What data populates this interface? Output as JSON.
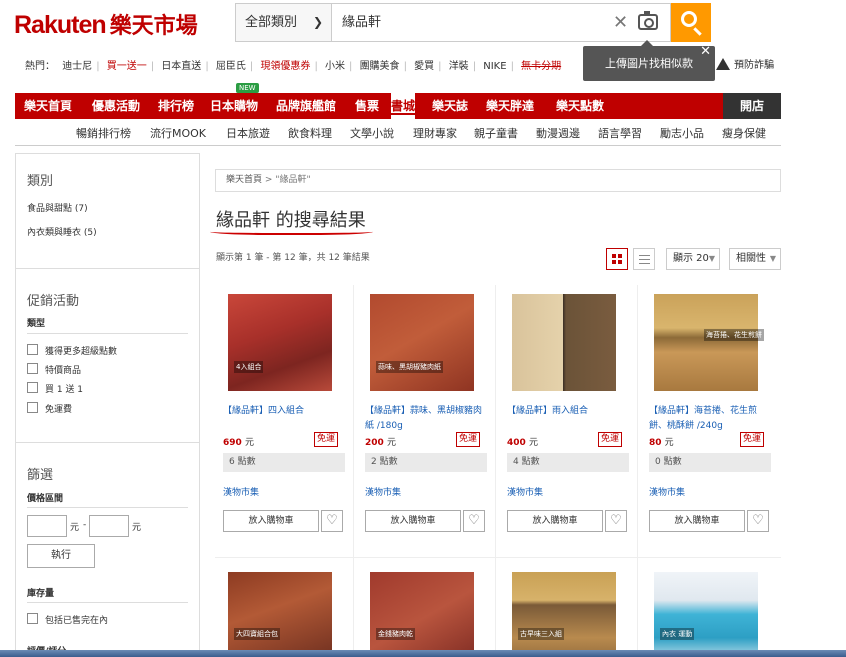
{
  "header": {
    "logo": "Rakuten",
    "logo_cn": "樂天市場",
    "category_label": "全部類別",
    "search_value": "緣品軒",
    "tooltip": "上傳圖片找相似款",
    "fraud_notice": "預防詐騙"
  },
  "hot": {
    "label": "熱門：",
    "items": [
      "迪士尼",
      "買一送一",
      "日本直送",
      "屈臣氏",
      "現領優惠券",
      "小米",
      "團購美食",
      "愛買",
      "洋裝",
      "NIKE",
      "無卡分期"
    ]
  },
  "rednav": {
    "items": [
      "樂天首頁",
      "優惠活動",
      "排行榜",
      "日本購物",
      "品牌旗艦館",
      "售票",
      "書城",
      "樂天誌",
      "樂天胖達",
      "樂天點數"
    ],
    "new_badge": "NEW",
    "store_btn": "開店"
  },
  "subnav": [
    "暢銷排行榜",
    "流行MOOK",
    "日本旅遊",
    "飲食料理",
    "文學小說",
    "理財專家",
    "親子童書",
    "動漫週邊",
    "語言學習",
    "勵志小品",
    "瘦身保健"
  ],
  "sidebar": {
    "cat_title": "類別",
    "categories": [
      "食品與甜點 (7)",
      "內衣類與睡衣 (5)"
    ],
    "promo_title": "促銷活動",
    "type_label": "類型",
    "promos": [
      "獲得更多超級點數",
      "特價商品",
      "買 1 送 1",
      "免運費"
    ],
    "filter_title": "篩選",
    "price_label": "價格區間",
    "unit": "元",
    "dash": "-",
    "exec": "執行",
    "stock_label": "庫存量",
    "stock_opt": "包括已售完在內",
    "more_label": "評價/評分"
  },
  "main": {
    "crumb_home": "樂天首頁",
    "crumb_sep": ">",
    "crumb_term": "\"緣品軒\"",
    "title": "緣品軒 的搜尋結果",
    "count": "顯示第 1 筆 - 第 12 筆，共 12 筆結果",
    "show_label": "顯示 20",
    "sort_label": "相關性"
  },
  "products": [
    {
      "name": "【緣品軒】四入組合",
      "price": "690",
      "unit": "元",
      "ship": "免運",
      "points": "6 點數",
      "shop": "漢物市集",
      "cart": "放入購物車",
      "img": "meat1",
      "cap": "4入組合"
    },
    {
      "name": "【緣品軒】蒜味、黑胡椒豬肉紙 /180g",
      "price": "200",
      "unit": "元",
      "ship": "免運",
      "points": "2 點數",
      "shop": "漢物市集",
      "cart": "放入購物車",
      "img": "meat2",
      "cap": "蒜味、黑胡椒豬肉紙"
    },
    {
      "name": "【緣品軒】雨入組合",
      "price": "400",
      "unit": "元",
      "ship": "免運",
      "points": "4 點數",
      "shop": "漢物市集",
      "cart": "放入購物車",
      "img": "nuts",
      "cap": ""
    },
    {
      "name": "【緣品軒】海苔捲、花生煎餅、桃酥餅 /240g",
      "price": "80",
      "unit": "元",
      "ship": "免運",
      "points": "0 點數",
      "shop": "漢物市集",
      "cart": "放入購物車",
      "img": "cookie",
      "cap": "海苔捲、花生煎餅"
    }
  ],
  "bottom_products": [
    {
      "img": "b1",
      "cap": "大四寶組合包"
    },
    {
      "img": "b2",
      "cap": "金錢豬肉乾"
    },
    {
      "img": "b3",
      "cap": "古早味三入組"
    },
    {
      "img": "b4",
      "cap": "內衣 運動"
    }
  ]
}
